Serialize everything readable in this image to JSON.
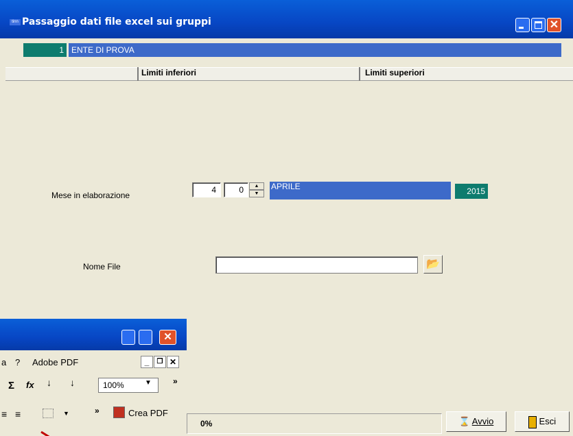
{
  "window": {
    "title": "Passaggio dati file excel sui gruppi",
    "app_icon_text": "tinn"
  },
  "ente": {
    "code": "1",
    "name": "ENTE DI PROVA"
  },
  "table_header": {
    "col_lower": "Limiti inferiori",
    "col_upper": "Limiti superiori"
  },
  "mese": {
    "label": "Mese in elaborazione",
    "month_num": "4",
    "spin_value": "0",
    "month_name": "APRILE",
    "year": "2015"
  },
  "file": {
    "label": "Nome File",
    "value": ""
  },
  "status": {
    "progress": "0%"
  },
  "buttons": {
    "avvio": "Avvio",
    "esci": "Esci"
  },
  "excel": {
    "menu": [
      "a",
      "?",
      "Adobe PDF"
    ],
    "toolbar": {
      "sum": "Σ",
      "fx": "fx",
      "zoom": "100%",
      "crea_pdf": "Crea PDF"
    }
  },
  "colors": {
    "title_blue": "#0746c4",
    "teal": "#0e7c6e",
    "field_blue": "#3d6ac9",
    "close_red": "#e0522a"
  }
}
